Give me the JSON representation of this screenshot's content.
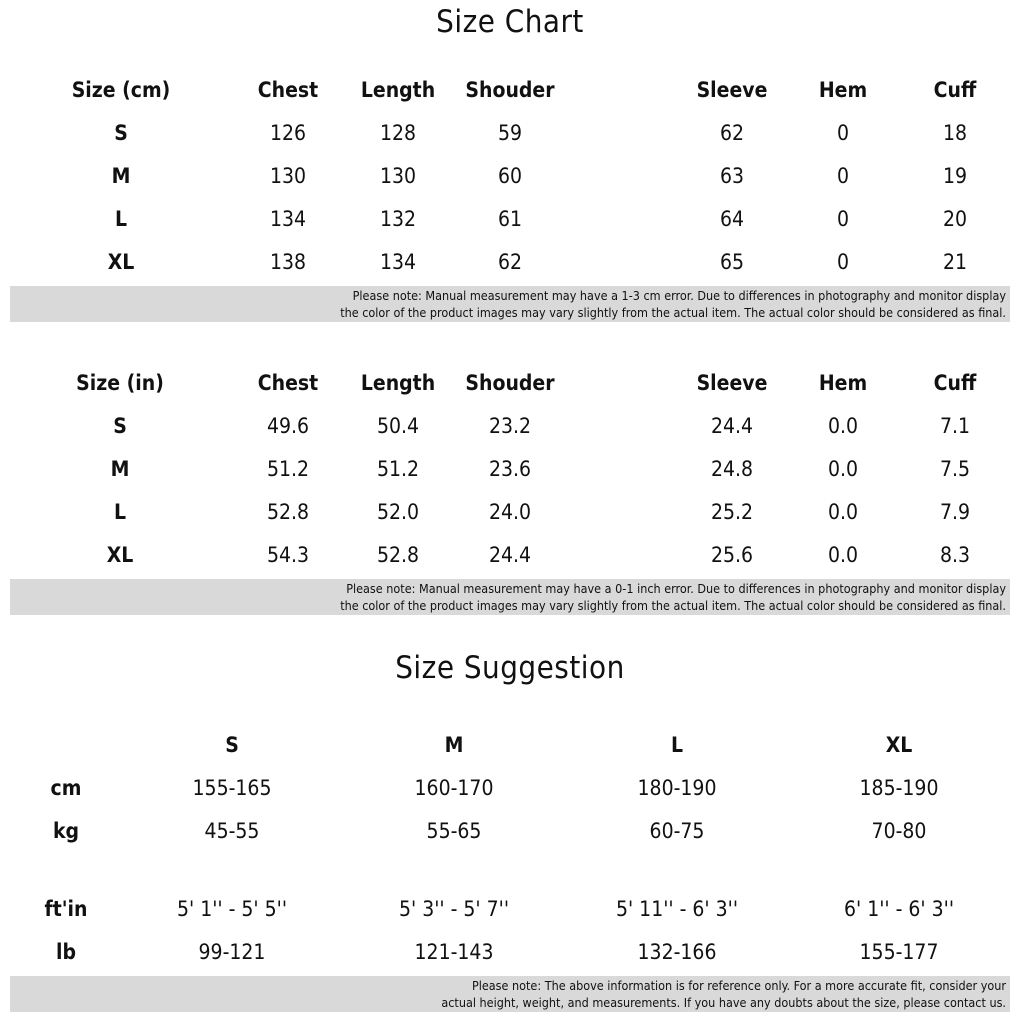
{
  "size_chart": {
    "title": "Size Chart",
    "cm_table": {
      "headers": [
        "Size (cm)",
        "Chest",
        "Length",
        "Shouder",
        "Sleeve",
        "Hem",
        "Cuff"
      ],
      "rows": [
        [
          "S",
          "126",
          "128",
          "59",
          "62",
          "0",
          "18"
        ],
        [
          "M",
          "130",
          "130",
          "60",
          "63",
          "0",
          "19"
        ],
        [
          "L",
          "134",
          "132",
          "61",
          "64",
          "0",
          "20"
        ],
        [
          "XL",
          "138",
          "134",
          "62",
          "65",
          "0",
          "21"
        ]
      ],
      "note": [
        "Please note: Manual measurement may have a 1-3 cm error. Due to differences in photography and monitor display",
        "the color of the product images may vary slightly from the actual item. The actual color should be considered as final."
      ]
    },
    "in_table": {
      "headers": [
        "Size (in)",
        "Chest",
        "Length",
        "Shouder",
        "Sleeve",
        "Hem",
        "Cuff"
      ],
      "rows": [
        [
          "S",
          "49.6",
          "50.4",
          "23.2",
          "24.4",
          "0.0",
          "7.1"
        ],
        [
          "M",
          "51.2",
          "51.2",
          "23.6",
          "24.8",
          "0.0",
          "7.5"
        ],
        [
          "L",
          "52.8",
          "52.0",
          "24.0",
          "25.2",
          "0.0",
          "7.9"
        ],
        [
          "XL",
          "54.3",
          "52.8",
          "24.4",
          "25.6",
          "0.0",
          "8.3"
        ]
      ],
      "note": [
        "Please note: Manual measurement may have a 0-1 inch error. Due to differences in photography and monitor display",
        "the color of the product images may vary slightly from the actual item. The actual color should be considered as final."
      ]
    }
  },
  "size_suggestion": {
    "title": "Size Suggestion",
    "sizes": [
      "S",
      "M",
      "L",
      "XL"
    ],
    "rows": [
      {
        "label": "cm",
        "values": [
          "155-165",
          "160-170",
          "180-190",
          "185-190"
        ]
      },
      {
        "label": "kg",
        "values": [
          "45-55",
          "55-65",
          "60-75",
          "70-80"
        ]
      },
      {
        "label": "ft'in",
        "values": [
          "5' 1'' - 5' 5''",
          "5' 3'' - 5' 7''",
          "5' 11'' - 6' 3''",
          "6' 1'' - 6' 3''"
        ]
      },
      {
        "label": "lb",
        "values": [
          "99-121",
          "121-143",
          "132-166",
          "155-177"
        ]
      }
    ],
    "note": [
      "Please note: The above information is for reference only. For a more accurate fit, consider your",
      "actual height, weight, and measurements. If you have any doubts about the size, please contact us."
    ]
  },
  "colors": {
    "text": "#111111",
    "note_background": "#d9d9d9",
    "background": "#ffffff"
  }
}
